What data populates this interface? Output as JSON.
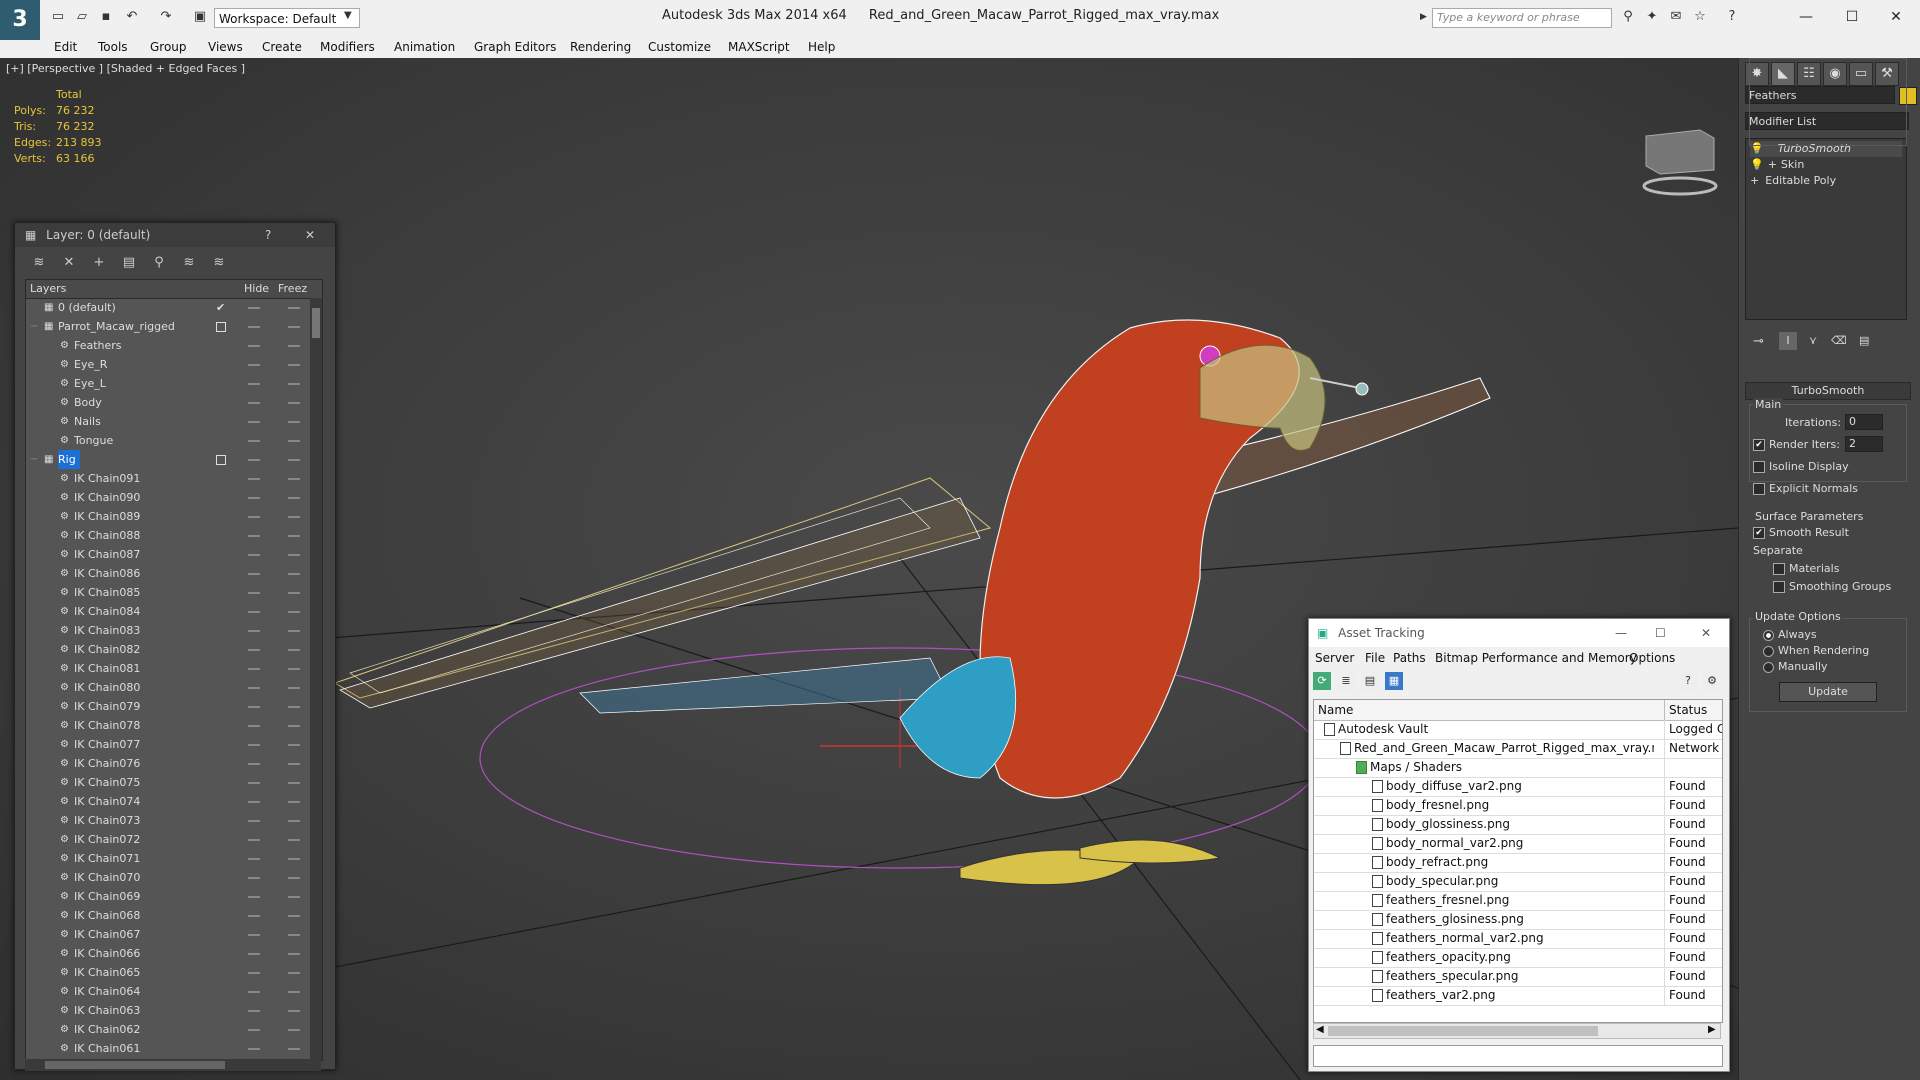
{
  "app": {
    "title": "Autodesk 3ds Max  2014 x64",
    "file": "Red_and_Green_Macaw_Parrot_Rigged_max_vray.max",
    "logo": "3",
    "workspace": "Workspace: Default",
    "search_placeholder": "Type a keyword or phrase"
  },
  "menu": [
    "Edit",
    "Tools",
    "Group",
    "Views",
    "Create",
    "Modifiers",
    "Animation",
    "Graph Editors",
    "Rendering",
    "Customize",
    "MAXScript",
    "Help"
  ],
  "viewport": {
    "label": "[+] [Perspective ] [Shaded + Edged Faces ]",
    "stats": {
      "header": "Total",
      "rows": [
        {
          "label": "Polys:",
          "value": "76 232"
        },
        {
          "label": "Tris:",
          "value": "76 232"
        },
        {
          "label": "Edges:",
          "value": "213 893"
        },
        {
          "label": "Verts:",
          "value": "63 166"
        }
      ]
    }
  },
  "layer_dialog": {
    "title": "Layer: 0 (default)",
    "help": "?",
    "close": "✕",
    "columns": {
      "layers": "Layers",
      "hide": "Hide",
      "freeze": "Freez"
    },
    "rows": [
      {
        "name": "0 (default)",
        "indent": 1
      },
      {
        "name": "Parrot_Macaw_rigged",
        "indent": 1
      },
      {
        "name": "Feathers",
        "indent": 2
      },
      {
        "name": "Eye_R",
        "indent": 2
      },
      {
        "name": "Eye_L",
        "indent": 2
      },
      {
        "name": "Body",
        "indent": 2
      },
      {
        "name": "Nails",
        "indent": 2
      },
      {
        "name": "Tongue",
        "indent": 2
      },
      {
        "name": "Rig",
        "indent": 1
      },
      {
        "name": "IK Chain091",
        "indent": 2
      },
      {
        "name": "IK Chain090",
        "indent": 2
      },
      {
        "name": "IK Chain089",
        "indent": 2
      },
      {
        "name": "IK Chain088",
        "indent": 2
      },
      {
        "name": "IK Chain087",
        "indent": 2
      },
      {
        "name": "IK Chain086",
        "indent": 2
      },
      {
        "name": "IK Chain085",
        "indent": 2
      },
      {
        "name": "IK Chain084",
        "indent": 2
      },
      {
        "name": "IK Chain083",
        "indent": 2
      },
      {
        "name": "IK Chain082",
        "indent": 2
      },
      {
        "name": "IK Chain081",
        "indent": 2
      },
      {
        "name": "IK Chain080",
        "indent": 2
      },
      {
        "name": "IK Chain079",
        "indent": 2
      },
      {
        "name": "IK Chain078",
        "indent": 2
      },
      {
        "name": "IK Chain077",
        "indent": 2
      },
      {
        "name": "IK Chain076",
        "indent": 2
      },
      {
        "name": "IK Chain075",
        "indent": 2
      },
      {
        "name": "IK Chain074",
        "indent": 2
      },
      {
        "name": "IK Chain073",
        "indent": 2
      },
      {
        "name": "IK Chain072",
        "indent": 2
      },
      {
        "name": "IK Chain071",
        "indent": 2
      },
      {
        "name": "IK Chain070",
        "indent": 2
      },
      {
        "name": "IK Chain069",
        "indent": 2
      },
      {
        "name": "IK Chain068",
        "indent": 2
      },
      {
        "name": "IK Chain067",
        "indent": 2
      },
      {
        "name": "IK Chain066",
        "indent": 2
      },
      {
        "name": "IK Chain065",
        "indent": 2
      },
      {
        "name": "IK Chain064",
        "indent": 2
      },
      {
        "name": "IK Chain063",
        "indent": 2
      },
      {
        "name": "IK Chain062",
        "indent": 2
      },
      {
        "name": "IK Chain061",
        "indent": 2
      }
    ]
  },
  "command_panel": {
    "object_name": "Feathers",
    "modifier_list": "Modifier List",
    "stack": [
      "TurboSmooth",
      "Skin",
      "Editable Poly"
    ],
    "rollout": "TurboSmooth",
    "main": "Main",
    "iterations_label": "Iterations:",
    "iterations_value": "0",
    "render_iters_label": "Render Iters:",
    "render_iters_value": "2",
    "isoline": "Isoline Display",
    "explicit": "Explicit Normals",
    "surface_params": "Surface Parameters",
    "smooth_result": "Smooth Result",
    "separate": "Separate",
    "materials": "Materials",
    "smoothing_groups": "Smoothing Groups",
    "update_options": "Update Options",
    "always": "Always",
    "when_rendering": "When Rendering",
    "manually": "Manually",
    "update": "Update"
  },
  "asset_tracking": {
    "title": "Asset Tracking",
    "menu": [
      "Server",
      "File",
      "Paths",
      "Bitmap Performance and Memory",
      "Options"
    ],
    "columns": {
      "name": "Name",
      "status": "Status"
    },
    "rows": [
      {
        "name": "Autodesk Vault",
        "status": "Logged Ou",
        "indent": 1
      },
      {
        "name": "Red_and_Green_Macaw_Parrot_Rigged_max_vray.max",
        "status": "Network Pa",
        "indent": 2
      },
      {
        "name": "Maps / Shaders",
        "status": "",
        "indent": 3
      },
      {
        "name": "body_diffuse_var2.png",
        "status": "Found",
        "indent": 4
      },
      {
        "name": "body_fresnel.png",
        "status": "Found",
        "indent": 4
      },
      {
        "name": "body_glossiness.png",
        "status": "Found",
        "indent": 4
      },
      {
        "name": "body_normal_var2.png",
        "status": "Found",
        "indent": 4
      },
      {
        "name": "body_refract.png",
        "status": "Found",
        "indent": 4
      },
      {
        "name": "body_specular.png",
        "status": "Found",
        "indent": 4
      },
      {
        "name": "feathers_fresnel.png",
        "status": "Found",
        "indent": 4
      },
      {
        "name": "feathers_glosiness.png",
        "status": "Found",
        "indent": 4
      },
      {
        "name": "feathers_normal_var2.png",
        "status": "Found",
        "indent": 4
      },
      {
        "name": "feathers_opacity.png",
        "status": "Found",
        "indent": 4
      },
      {
        "name": "feathers_specular.png",
        "status": "Found",
        "indent": 4
      },
      {
        "name": "feathers_var2.png",
        "status": "Found",
        "indent": 4
      }
    ]
  }
}
